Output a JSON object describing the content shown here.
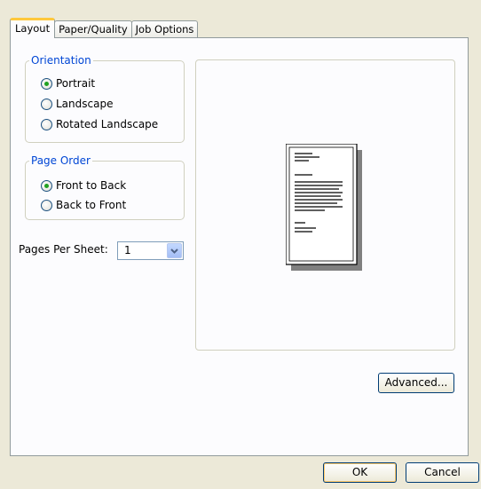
{
  "tabs": [
    "Layout",
    "Paper/Quality",
    "Job Options"
  ],
  "orientation": {
    "legend": "Orientation",
    "options": [
      "Portrait",
      "Landscape",
      "Rotated Landscape"
    ],
    "selected": "Portrait"
  },
  "page_order": {
    "legend": "Page Order",
    "options": [
      "Front to Back",
      "Back to Front"
    ],
    "selected": "Front to Back"
  },
  "pages_per_sheet": {
    "label": "Pages Per Sheet:",
    "value": "1"
  },
  "buttons": {
    "advanced": "Advanced...",
    "ok": "OK",
    "cancel": "Cancel"
  },
  "colors": {
    "legend": "#0046d5",
    "radio_dot": "#21a121",
    "tab_highlight": "#ffc83c",
    "dialog_bg": "#ece9d8"
  },
  "icons": {
    "preview": "document-page-icon",
    "dropdown": "chevron-down-icon"
  }
}
